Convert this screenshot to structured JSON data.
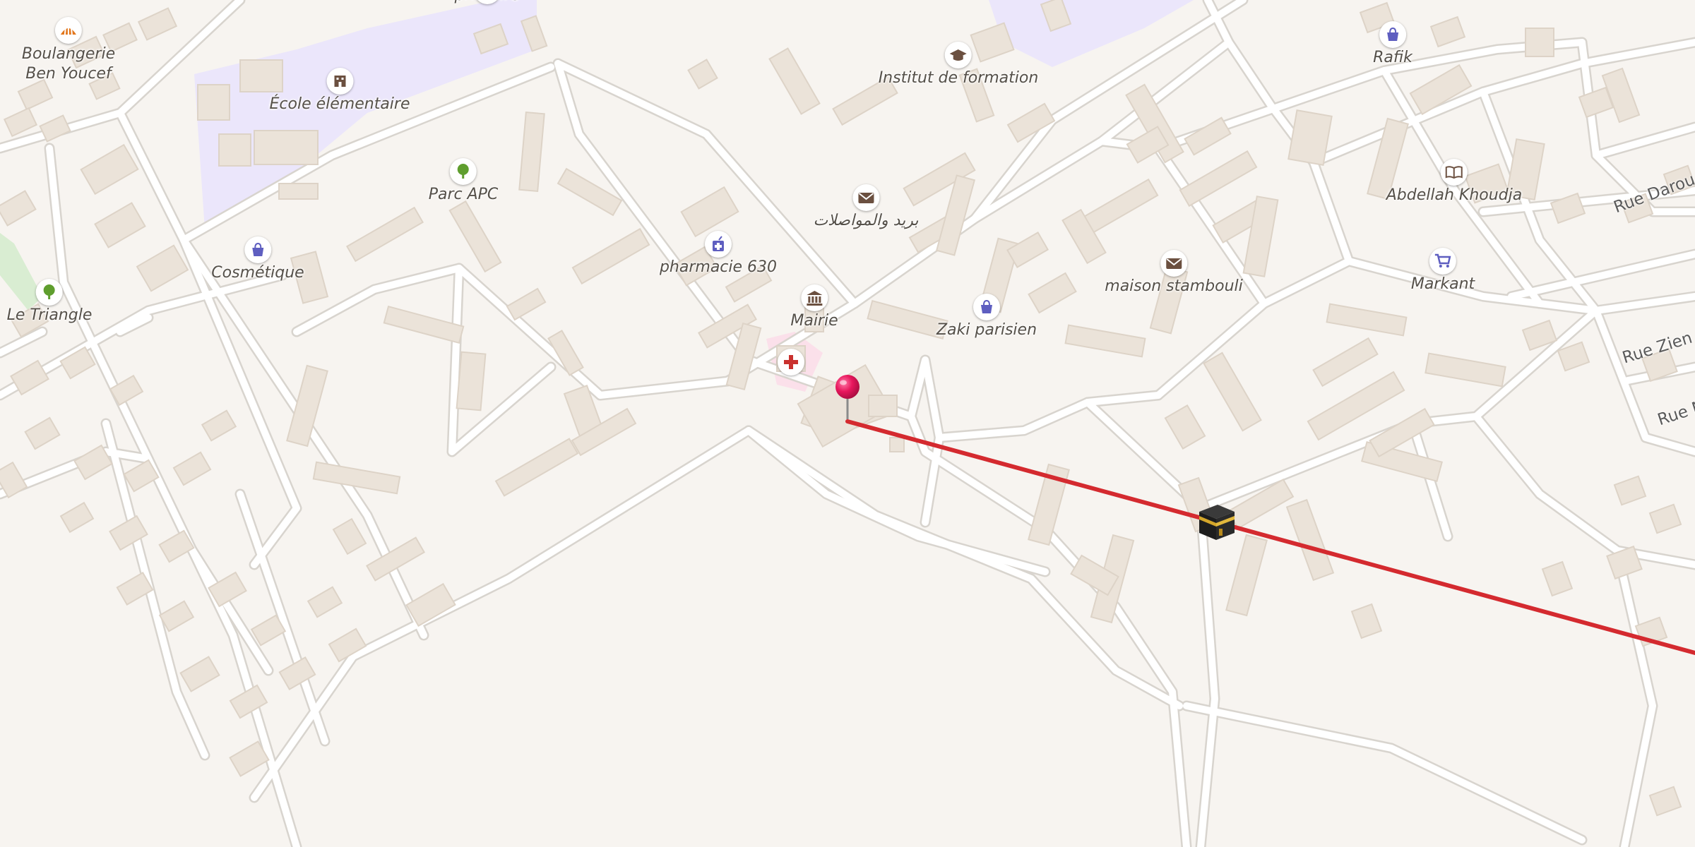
{
  "map": {
    "colors": {
      "background": "#f7f4f0",
      "building": "#ebe3d9",
      "building_edge": "#ddd3c7",
      "school_area": "#ebe6fb",
      "park_area": "#d9edd2",
      "hospital_area": "#fbe0ea",
      "road": "#ffffff",
      "road_casing": "#d8d4ce",
      "qibla_line": "#d42a2f",
      "pin": "#e8175d",
      "shop_icon": "#5e5ec0",
      "park_icon": "#5f9e2e",
      "bakery_icon": "#e2761c",
      "civic_icon": "#6b5040",
      "medical_icon": "#c9312e"
    },
    "pois": [
      {
        "name": "primaire",
        "icon": "school-icon"
      },
      {
        "name": "Boulangerie\nBen Youcef",
        "icon": "bakery-icon"
      },
      {
        "name": "École élémentaire",
        "icon": "school-icon"
      },
      {
        "name": "Institut de formation",
        "icon": "graduation-cap-icon"
      },
      {
        "name": "Rafik",
        "icon": "shopping-bag-icon"
      },
      {
        "name": "Parc APC",
        "icon": "tree-icon"
      },
      {
        "name": "بريد والمواصلات",
        "icon": "envelope-icon"
      },
      {
        "name": "Abdellah Khoudja",
        "icon": "book-icon"
      },
      {
        "name": "Cosmétique",
        "icon": "shopping-bag-icon"
      },
      {
        "name": "pharmacie 630",
        "icon": "pharmacy-icon"
      },
      {
        "name": "maison stambouli",
        "icon": "envelope-icon"
      },
      {
        "name": "Markant",
        "icon": "cart-icon"
      },
      {
        "name": "Le Triangle",
        "icon": "tree-icon"
      },
      {
        "name": "Mairie",
        "icon": "town-hall-icon"
      },
      {
        "name": "Zaki parisien",
        "icon": "shopping-bag-icon"
      }
    ],
    "streets": [
      {
        "name": "Rue Darou"
      },
      {
        "name": "Rue Zien"
      },
      {
        "name": "Rue M"
      }
    ],
    "markers": {
      "location_pin": "map-pin-icon",
      "kaaba": "kaaba-icon",
      "hospital": "medical-cross-icon"
    }
  }
}
